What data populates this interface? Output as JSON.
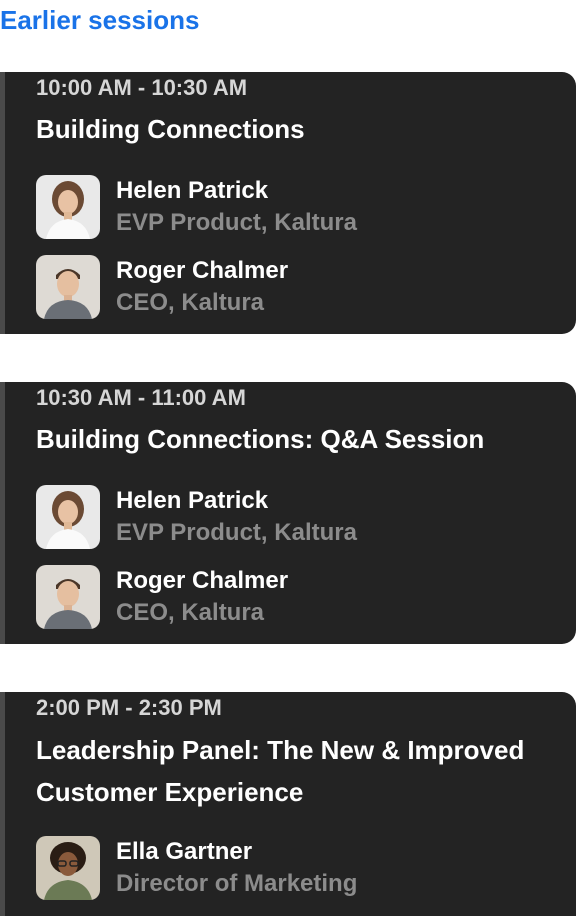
{
  "section": {
    "title": "Earlier sessions"
  },
  "sessions": [
    {
      "time": "10:00 AM - 10:30 AM",
      "title": "Building Connections",
      "speakers": [
        {
          "name": "Helen Patrick",
          "role": "EVP Product, Kaltura",
          "avatar": "woman-curly-hair-photo"
        },
        {
          "name": "Roger Chalmer",
          "role": "CEO, Kaltura",
          "avatar": "man-short-hair-photo"
        }
      ]
    },
    {
      "time": "10:30 AM - 11:00 AM",
      "title": "Building Connections: Q&A Session",
      "speakers": [
        {
          "name": "Helen Patrick",
          "role": "EVP Product, Kaltura",
          "avatar": "woman-curly-hair-photo"
        },
        {
          "name": "Roger Chalmer",
          "role": "CEO, Kaltura",
          "avatar": "man-short-hair-photo"
        }
      ]
    },
    {
      "time": "2:00 PM - 2:30 PM",
      "title": "Leadership Panel: The New & Improved Customer Experience",
      "speakers": [
        {
          "name": "Ella Gartner",
          "role": "Director of Marketing",
          "avatar": "woman-glasses-photo"
        }
      ]
    }
  ],
  "colors": {
    "accent": "#1a73e8",
    "card_bg": "#232323",
    "card_edge": "#4a4a4a",
    "time_text": "#d6d6d6",
    "role_text": "#8c8c8c"
  }
}
